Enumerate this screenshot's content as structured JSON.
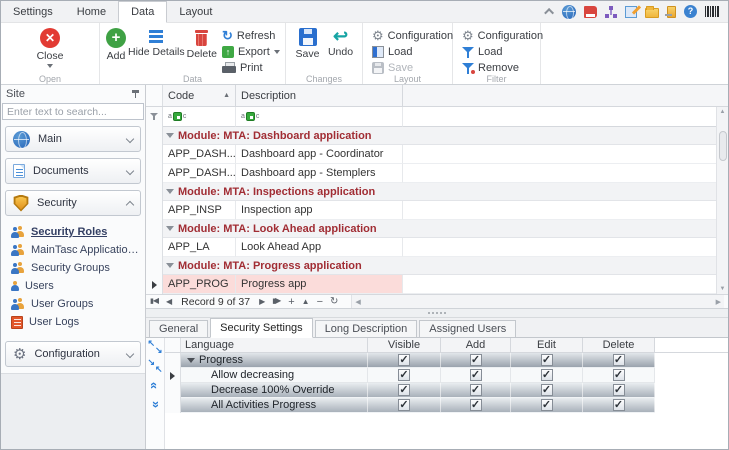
{
  "ribbon": {
    "tabs": [
      "Settings",
      "Home",
      "Data",
      "Layout"
    ],
    "active_tab": "Data",
    "groups": {
      "open": {
        "label": "Open",
        "close": "Close"
      },
      "data": {
        "label": "Data",
        "add": "Add",
        "hide_details": "Hide Details",
        "delete": "Delete",
        "refresh": "Refresh",
        "export": "Export",
        "print": "Print"
      },
      "changes": {
        "label": "Changes",
        "save": "Save",
        "undo": "Undo"
      },
      "layout": {
        "label": "Layout",
        "configuration": "Configuration",
        "load": "Load",
        "save": "Save"
      },
      "filter": {
        "label": "Filter",
        "configuration": "Configuration",
        "load": "Load",
        "remove": "Remove"
      }
    },
    "window_icons": [
      "collapse-ribbon",
      "globe",
      "book",
      "org-share",
      "edit",
      "folder",
      "exit",
      "help",
      "barcode"
    ]
  },
  "sidebar": {
    "title": "Site",
    "search_placeholder": "Enter text to search...",
    "groups": {
      "main": "Main",
      "documents": "Documents",
      "security": "Security",
      "configuration": "Configuration"
    },
    "security_items": [
      {
        "label": "Security Roles",
        "selected": true
      },
      {
        "label": "MainTasc Applications Licen...",
        "selected": false
      },
      {
        "label": "Security Groups",
        "selected": false
      },
      {
        "label": "Users",
        "selected": false
      },
      {
        "label": "User Groups",
        "selected": false
      },
      {
        "label": "User Logs",
        "selected": false
      }
    ]
  },
  "grid": {
    "columns": {
      "code": "Code",
      "description": "Description"
    },
    "sorted_column": "Code",
    "rows": [
      {
        "type": "group",
        "label": "Module: MTA: Dashboard application"
      },
      {
        "type": "row",
        "code": "APP_DASH...",
        "desc": "Dashboard app - Coordinator"
      },
      {
        "type": "row",
        "code": "APP_DASH...",
        "desc": "Dashboard app - Stemplers"
      },
      {
        "type": "group",
        "label": "Module: MTA: Inspections application"
      },
      {
        "type": "row",
        "code": "APP_INSP",
        "desc": "Inspection app"
      },
      {
        "type": "group",
        "label": "Module: MTA: Look Ahead application"
      },
      {
        "type": "row",
        "code": "APP_LA",
        "desc": "Look Ahead App"
      },
      {
        "type": "group",
        "label": "Module: MTA: Progress application"
      },
      {
        "type": "row",
        "code": "APP_PROG",
        "desc": "Progress app",
        "selected": true
      }
    ],
    "navigator": {
      "record_text": "Record 9 of 37"
    }
  },
  "detail": {
    "tabs": [
      "General",
      "Security Settings",
      "Long Description",
      "Assigned Users"
    ],
    "active_tab": "Security Settings",
    "grid": {
      "columns": {
        "language": "Language",
        "visible": "Visible",
        "add": "Add",
        "edit": "Edit",
        "delete": "Delete"
      },
      "rows": [
        {
          "label": "Progress",
          "group": true,
          "checks": [
            "✓",
            "✓",
            "✓",
            "✓"
          ]
        },
        {
          "label": "Allow decreasing",
          "current": true,
          "checks": [
            "✓",
            "✓",
            "✓",
            "✓"
          ]
        },
        {
          "label": "Decrease 100% Override",
          "checks": [
            "✓",
            "✓",
            "✓",
            "✓"
          ]
        },
        {
          "label": "All Activities Progress",
          "checks": [
            "✓",
            "✓",
            "✓",
            "✓"
          ]
        }
      ]
    }
  }
}
